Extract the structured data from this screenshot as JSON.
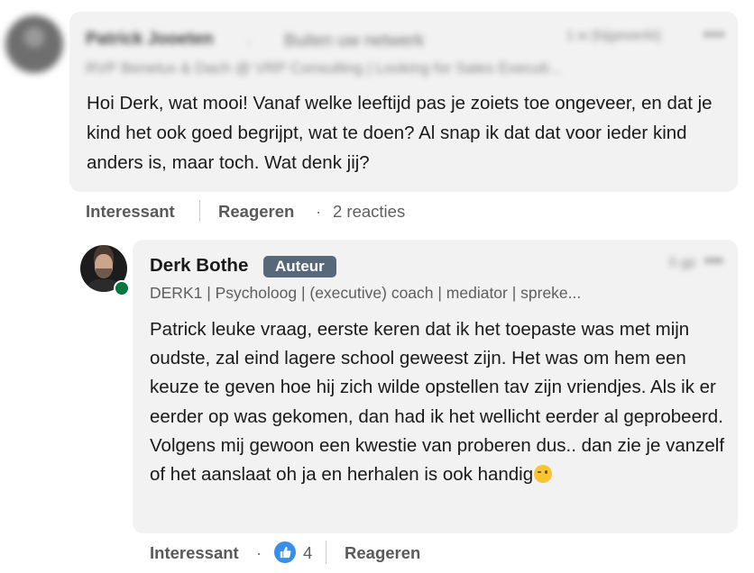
{
  "comment1": {
    "author_name": "Patrick Jooeten",
    "connection": "Buiten uw netwerk",
    "headline": "RVP Benelux & Dach @ VRP Consulting | Looking for Sales Executi...",
    "time": "1 w (bijgewerkt)",
    "more": "•••",
    "text": "Hoi Derk, wat mooi! Vanaf welke leeftijd pas je zoiets toe ongeveer, en dat je kind het ook goed begrijpt, wat te doen? Al snap ik dat dat voor ieder kind anders is, maar toch. Wat denk jij?",
    "actions": {
      "like": "Interessant",
      "reply": "Reageren",
      "replies": "2 reacties"
    }
  },
  "comment2": {
    "author_name": "Derk Bothe",
    "badge": "Auteur",
    "headline": "DERK1 | Psycholoog | (executive) coach | mediator | spreke...",
    "time": "5 gp",
    "more": "•••",
    "text": "Patrick leuke vraag, eerste keren dat ik het toepaste was met mijn oudste, zal eind lagere school geweest zijn. Het was om hem een keuze te geven hoe hij zich wilde opstellen tav zijn vriendjes. Als ik er eerder op was gekomen, dan had ik het wellicht eerder al geprobeerd. Volgens mij gewoon een kwestie van proberen dus.. dan zie je vanzelf of het aanslaat oh ja en herhalen is ook handig",
    "actions": {
      "like": "Interessant",
      "reaction_count": "4",
      "reply": "Reageren"
    }
  },
  "icons": {
    "wink": "winking-face-emoji",
    "like": "thumbs-up-icon"
  },
  "colors": {
    "bubble_bg": "#f2f2f2",
    "badge_bg": "#56687a",
    "online": "#057642",
    "like_blue": "#378fe9"
  }
}
